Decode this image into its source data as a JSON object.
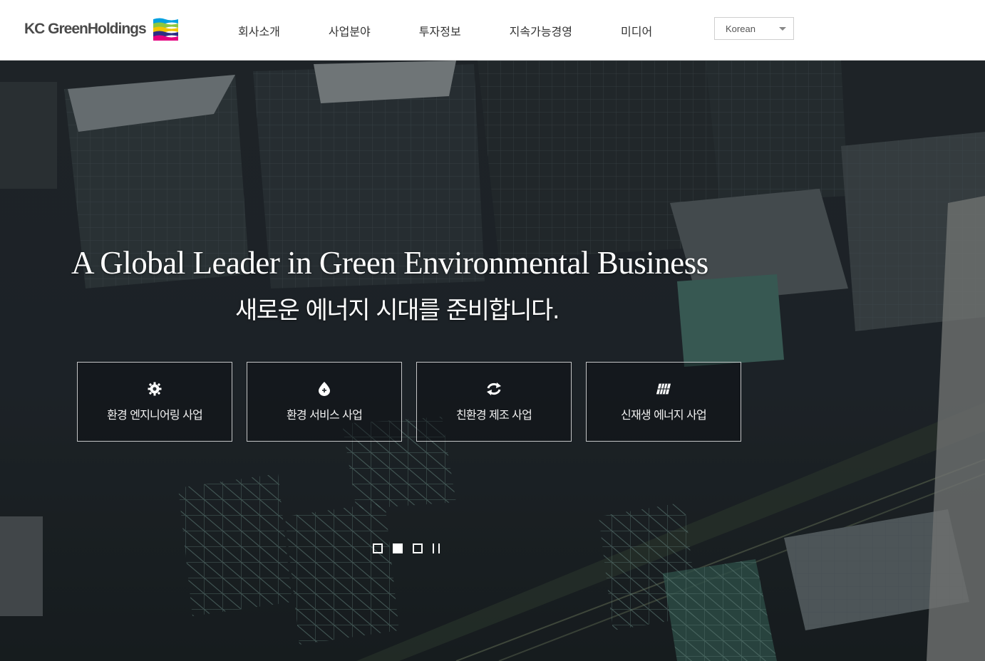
{
  "header": {
    "logo_text": "KC GreenHoldings",
    "logo_colors": [
      "#00a0e0",
      "#8cc63f",
      "#f2c500",
      "#2d2e83",
      "#e4007f"
    ],
    "nav": [
      {
        "label": "회사소개"
      },
      {
        "label": "사업분야"
      },
      {
        "label": "투자정보"
      },
      {
        "label": "지속가능경영"
      },
      {
        "label": "미디어"
      }
    ],
    "language": {
      "selected": "Korean"
    }
  },
  "hero": {
    "title": "A Global Leader in Green Environmental Business",
    "subtitle": "새로운 에너지 시대를 준비합니다.",
    "businesses": [
      {
        "label": "환경 엔지니어링 사업",
        "icon": "gear-icon"
      },
      {
        "label": "환경 서비스 사업",
        "icon": "drop-icon"
      },
      {
        "label": "친환경 제조 사업",
        "icon": "recycle-icon"
      },
      {
        "label": "신재생 에너지 사업",
        "icon": "solar-panel-icon"
      }
    ],
    "slider": {
      "slides": 3,
      "active": 2,
      "control": "pause-icon"
    }
  }
}
